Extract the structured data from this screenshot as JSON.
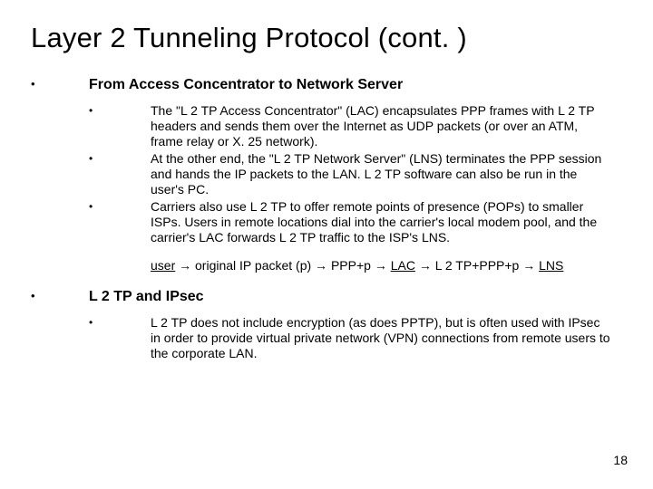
{
  "title": "Layer 2 Tunneling Protocol (cont. )",
  "section1": {
    "heading": "From Access Concentrator to Network Server",
    "items": [
      "The \"L 2 TP Access Concentrator\" (LAC) encapsulates PPP frames with L 2 TP headers and sends them over the Internet as UDP packets (or over an ATM, frame relay or X. 25 network).",
      "At the other end, the \"L 2 TP Network Server\" (LNS) terminates the PPP session and hands the IP packets to the LAN. L 2 TP software can also be run in the user's PC.",
      "Carriers also use L 2 TP to offer remote points of presence (POPs) to smaller ISPs. Users in remote locations dial into the carrier's local modem pool, and the carrier's LAC forwards L 2 TP traffic to the ISP's LNS."
    ]
  },
  "flow": {
    "n0": "user",
    "n1": "original IP packet (p)",
    "n2": "PPP+p",
    "n3": "LAC",
    "n4": "L 2 TP+PPP+p",
    "n5": "LNS",
    "arrow": "→"
  },
  "section2": {
    "heading": "L 2 TP and IPsec",
    "items": [
      "L 2 TP does not include encryption (as does PPTP), but is often used with IPsec in order to provide virtual private network (VPN) connections from remote users to the corporate LAN."
    ]
  },
  "page_number": "18",
  "bullet": "•"
}
